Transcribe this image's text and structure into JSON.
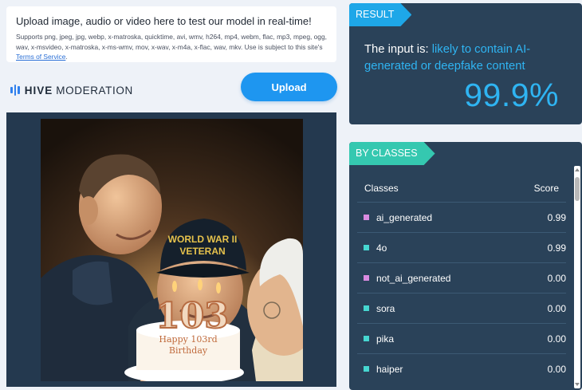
{
  "upload": {
    "title": "Upload image, audio or video here to test our model in real-time!",
    "formats_text": "Supports png, jpeg, jpg, webp, x-matroska, quicktime, avi, wmv, h264, mp4, webm, flac, mp3, mpeg, ogg, wav, x-msvideo, x-matroska, x-ms-wmv, mov, x-wav, x-m4a, x-flac, wav, mkv. Use is subject to this site's",
    "terms_link": "Terms of Service",
    "terms_suffix": ".",
    "button_label": "Upload"
  },
  "brand": {
    "name_bold": "HIVE",
    "name_rest": "MODERATION",
    "accent": "#2f80ed"
  },
  "image": {
    "cake_number": "103",
    "cake_text_line1": "Happy 103rd",
    "cake_text_line2": "Birthday",
    "cap_line1": "WORLD WAR II",
    "cap_line2": "VETERAN"
  },
  "result": {
    "tag": "RESULT",
    "prefix": "The input is:",
    "verdict": "likely to contain AI-generated or deepfake content",
    "score": "99.9%",
    "accent": "#2fb4f2"
  },
  "classes": {
    "tag": "BY CLASSES",
    "header_class": "Classes",
    "header_score": "Score",
    "rows": [
      {
        "name": "ai_generated",
        "score": "0.99",
        "swatch": "#d98be0"
      },
      {
        "name": "4o",
        "score": "0.99",
        "swatch": "#46d6d0"
      },
      {
        "name": "not_ai_generated",
        "score": "0.00",
        "swatch": "#d98be0"
      },
      {
        "name": "sora",
        "score": "0.00",
        "swatch": "#46d6d0"
      },
      {
        "name": "pika",
        "score": "0.00",
        "swatch": "#46d6d0"
      },
      {
        "name": "haiper",
        "score": "0.00",
        "swatch": "#46d6d0"
      }
    ]
  }
}
